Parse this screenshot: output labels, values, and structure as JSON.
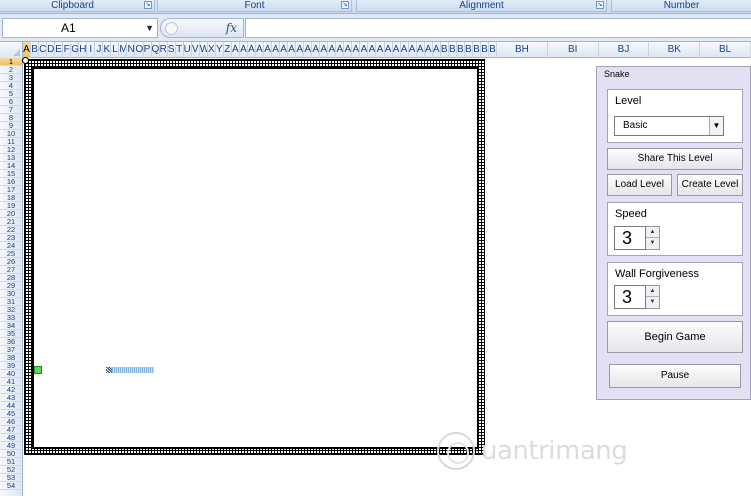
{
  "ribbon": {
    "groups": [
      {
        "label": "Clipboard"
      },
      {
        "label": "Font"
      },
      {
        "label": "Alignment"
      },
      {
        "label": "Number"
      }
    ]
  },
  "formula_bar": {
    "name_box": "A1",
    "fx_label": "fx",
    "formula_value": ""
  },
  "columns": {
    "narrow": [
      "A",
      "B",
      "C",
      "D",
      "E",
      "F",
      "G",
      "H",
      "I",
      "J",
      "K",
      "L",
      "M",
      "N",
      "O",
      "P",
      "Q",
      "R",
      "S",
      "T",
      "U",
      "V",
      "W",
      "X",
      "Y",
      "Z",
      "A",
      "A",
      "A",
      "A",
      "A",
      "A",
      "A",
      "A",
      "A",
      "A",
      "A",
      "A",
      "A",
      "A",
      "A",
      "A",
      "A",
      "A",
      "A",
      "A",
      "A",
      "A",
      "A",
      "A",
      "A",
      "A",
      "B",
      "B",
      "B",
      "B",
      "B",
      "B",
      "B"
    ],
    "wide": [
      "BH",
      "BI",
      "BJ",
      "BK",
      "BL"
    ],
    "selected": "A"
  },
  "rows": {
    "labels": [
      "1",
      "2",
      "3",
      "4",
      "5",
      "6",
      "7",
      "8",
      "9",
      "10",
      "11",
      "12",
      "13",
      "14",
      "15",
      "16",
      "17",
      "18",
      "19",
      "20",
      "21",
      "22",
      "23",
      "24",
      "25",
      "26",
      "27",
      "28",
      "29",
      "30",
      "31",
      "32",
      "33",
      "34",
      "35",
      "36",
      "37",
      "38",
      "39",
      "40",
      "41",
      "42",
      "43",
      "44",
      "45",
      "46",
      "47",
      "48",
      "49",
      "50",
      "51",
      "52",
      "53",
      "54"
    ],
    "selected": "1"
  },
  "panel": {
    "title": "Snake",
    "level": {
      "label": "Level",
      "selected": "Basic"
    },
    "share_button": "Share This Level",
    "load_button": "Load Level",
    "create_button": "Create Level",
    "speed": {
      "label": "Speed",
      "value": "3"
    },
    "wall": {
      "label": "Wall Forgiveness",
      "value": "3"
    },
    "begin_button": "Begin Game",
    "pause_button": "Pause"
  },
  "watermark": {
    "text": "uantrimang"
  },
  "colors": {
    "panel_bg": "#e4e0f3",
    "header_blue": "#15428b",
    "selection_orange": "#f1c15f",
    "snake_head": "#5fd65f",
    "snake_body": "#7fb0e0"
  }
}
